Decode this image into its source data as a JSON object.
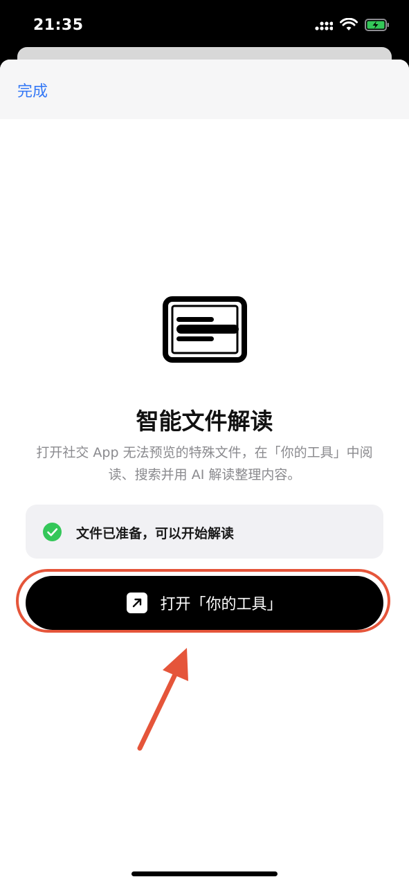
{
  "status_bar": {
    "time": "21:35"
  },
  "header": {
    "done_label": "完成"
  },
  "content": {
    "title": "智能文件解读",
    "subtitle": "打开社交 App 无法预览的特殊文件，在「你的工具」中阅读、搜索并用 AI 解读整理内容。"
  },
  "status_card": {
    "text": "文件已准备，可以开始解读",
    "icon": "check-circle-icon"
  },
  "open_button": {
    "label": "打开「你的工具」",
    "icon": "arrow-up-right-icon"
  },
  "colors": {
    "accent": "#3478f6",
    "success": "#34c759",
    "annotation": "#e5553a"
  }
}
